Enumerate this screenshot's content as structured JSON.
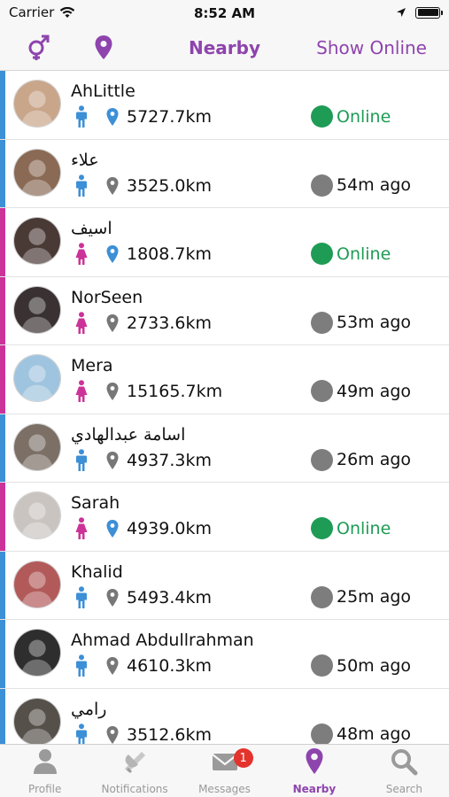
{
  "statusbar": {
    "carrier": "Carrier",
    "time": "8:52 AM"
  },
  "navbar": {
    "title": "Nearby",
    "show_online": "Show Online",
    "left_icons": [
      "gender-filter-icon",
      "location-pin-icon"
    ]
  },
  "colors": {
    "accent": "#8e44ad",
    "male": "#3d8fd6",
    "female": "#cc3399",
    "online": "#1e9c55",
    "offline": "#7d7d7d",
    "badge": "#e4332c"
  },
  "users": [
    {
      "name": "AhLittle",
      "gender": "male",
      "distance": "5727.7km",
      "pin_active": true,
      "status": "Online",
      "online": true,
      "avatar_color": "#c9a58a"
    },
    {
      "name": "علاء",
      "gender": "male",
      "distance": "3525.0km",
      "pin_active": false,
      "status": "54m ago",
      "online": false,
      "avatar_color": "#8a6a55"
    },
    {
      "name": "اسيف",
      "gender": "female",
      "distance": "1808.7km",
      "pin_active": true,
      "status": "Online",
      "online": true,
      "avatar_color": "#4a3a35"
    },
    {
      "name": "NorSeen",
      "gender": "female",
      "distance": "2733.6km",
      "pin_active": false,
      "status": "53m ago",
      "online": false,
      "avatar_color": "#3a3232"
    },
    {
      "name": "Mera",
      "gender": "female",
      "distance": "15165.7km",
      "pin_active": false,
      "status": "49m ago",
      "online": false,
      "avatar_color": "#9fc4df"
    },
    {
      "name": "اسامة عبدالهادي",
      "gender": "male",
      "distance": "4937.3km",
      "pin_active": false,
      "status": "26m ago",
      "online": false,
      "avatar_color": "#7b6f66"
    },
    {
      "name": "Sarah",
      "gender": "female",
      "distance": "4939.0km",
      "pin_active": true,
      "status": "Online",
      "online": true,
      "avatar_color": "#c9c4c0"
    },
    {
      "name": "Khalid",
      "gender": "male",
      "distance": "5493.4km",
      "pin_active": false,
      "status": "25m ago",
      "online": false,
      "avatar_color": "#b25a5a"
    },
    {
      "name": "Ahmad Abdullrahman",
      "gender": "male",
      "distance": "4610.3km",
      "pin_active": false,
      "status": "50m ago",
      "online": false,
      "avatar_color": "#2e2e2e"
    },
    {
      "name": "رامي",
      "gender": "male",
      "distance": "3512.6km",
      "pin_active": false,
      "status": "48m ago",
      "online": false,
      "avatar_color": "#55504a"
    }
  ],
  "tabs": [
    {
      "label": "Profile",
      "icon": "person-icon",
      "active": false
    },
    {
      "label": "Notifications",
      "icon": "megaphone-icon",
      "active": false
    },
    {
      "label": "Messages",
      "icon": "envelope-icon",
      "active": false,
      "badge": "1"
    },
    {
      "label": "Nearby",
      "icon": "location-pin-icon",
      "active": true
    },
    {
      "label": "Search",
      "icon": "magnifier-icon",
      "active": false
    }
  ]
}
